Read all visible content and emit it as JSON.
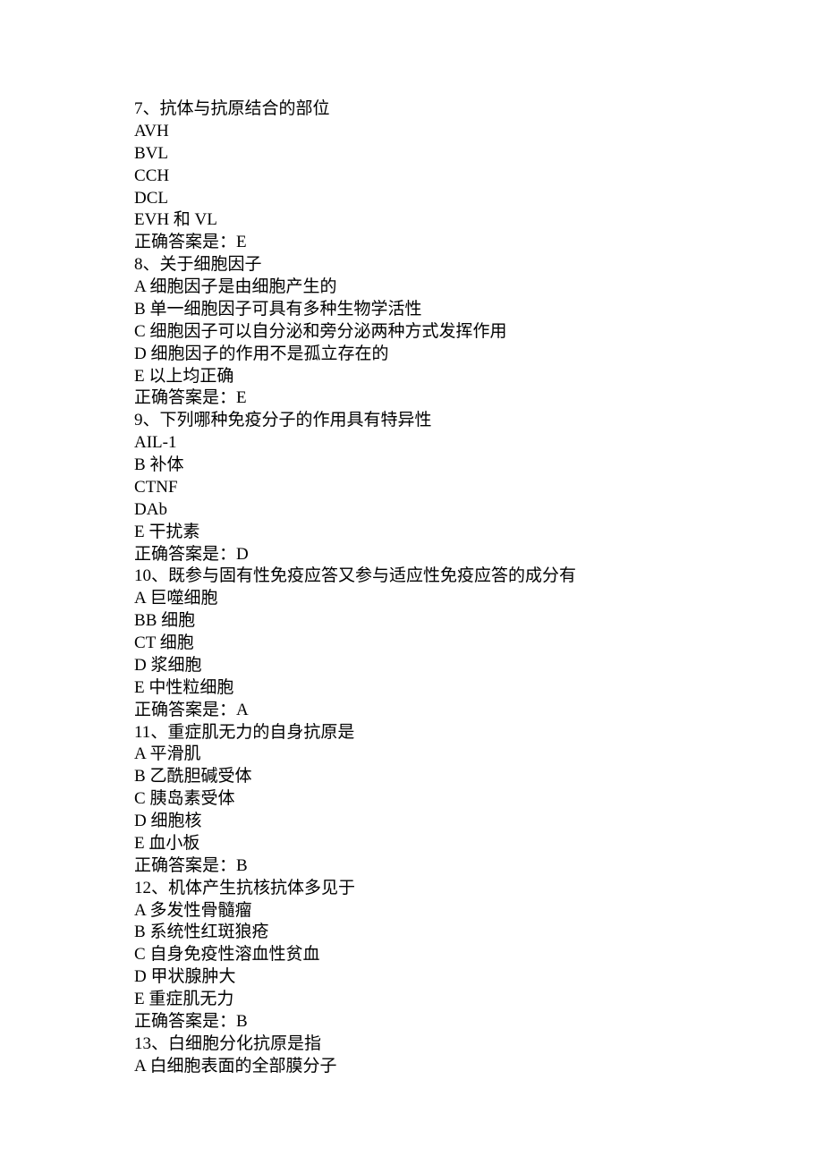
{
  "questions": [
    {
      "num": "7",
      "stem": "抗体与抗原结合的部位",
      "options": [
        {
          "key": "A",
          "text": "VH"
        },
        {
          "key": "B",
          "text": "VL"
        },
        {
          "key": "C",
          "text": "CH"
        },
        {
          "key": "D",
          "text": "CL"
        },
        {
          "key": "E",
          "text": "VH 和 VL"
        }
      ],
      "answer_label": "正确答案是：",
      "answer": "E"
    },
    {
      "num": "8",
      "stem": "关于细胞因子",
      "options": [
        {
          "key": "A",
          "text": " 细胞因子是由细胞产生的"
        },
        {
          "key": "B",
          "text": " 单一细胞因子可具有多种生物学活性"
        },
        {
          "key": "C",
          "text": " 细胞因子可以自分泌和旁分泌两种方式发挥作用"
        },
        {
          "key": "D",
          "text": " 细胞因子的作用不是孤立存在的"
        },
        {
          "key": "E",
          "text": " 以上均正确"
        }
      ],
      "answer_label": "正确答案是：",
      "answer": "E"
    },
    {
      "num": "9",
      "stem": "下列哪种免疫分子的作用具有特异性",
      "options": [
        {
          "key": "A",
          "text": "IL-1"
        },
        {
          "key": "B",
          "text": " 补体"
        },
        {
          "key": "C",
          "text": "TNF"
        },
        {
          "key": "D",
          "text": "Ab"
        },
        {
          "key": "E",
          "text": " 干扰素"
        }
      ],
      "answer_label": "正确答案是：",
      "answer": "D"
    },
    {
      "num": "10",
      "stem": "既参与固有性免疫应答又参与适应性免疫应答的成分有",
      "options": [
        {
          "key": "A",
          "text": " 巨噬细胞"
        },
        {
          "key": "B",
          "text": "B 细胞"
        },
        {
          "key": "C",
          "text": "T 细胞"
        },
        {
          "key": "D",
          "text": " 浆细胞"
        },
        {
          "key": "E",
          "text": " 中性粒细胞"
        }
      ],
      "answer_label": "正确答案是：",
      "answer": "A"
    },
    {
      "num": "11",
      "stem": "重症肌无力的自身抗原是",
      "options": [
        {
          "key": "A",
          "text": " 平滑肌"
        },
        {
          "key": "B",
          "text": " 乙酰胆碱受体"
        },
        {
          "key": "C",
          "text": " 胰岛素受体"
        },
        {
          "key": "D",
          "text": " 细胞核"
        },
        {
          "key": "E",
          "text": " 血小板"
        }
      ],
      "answer_label": "正确答案是：",
      "answer": "B"
    },
    {
      "num": "12",
      "stem": "机体产生抗核抗体多见于",
      "options": [
        {
          "key": "A",
          "text": " 多发性骨髓瘤"
        },
        {
          "key": "B",
          "text": " 系统性红斑狼疮"
        },
        {
          "key": "C",
          "text": " 自身免疫性溶血性贫血"
        },
        {
          "key": "D",
          "text": " 甲状腺肿大"
        },
        {
          "key": "E",
          "text": " 重症肌无力"
        }
      ],
      "answer_label": "正确答案是：",
      "answer": "B"
    },
    {
      "num": "13",
      "stem": "白细胞分化抗原是指",
      "options": [
        {
          "key": "A",
          "text": " 白细胞表面的全部膜分子"
        }
      ],
      "answer_label": "",
      "answer": ""
    }
  ]
}
